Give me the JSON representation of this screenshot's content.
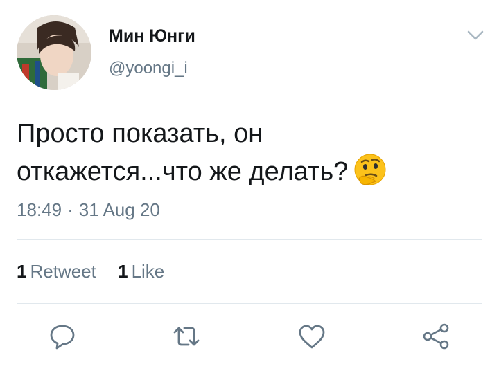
{
  "tweet": {
    "author": {
      "display_name": "Мин Юнги",
      "handle": "@yoongi_i"
    },
    "text_lines": [
      "Просто показать, он",
      "откажется...что же делать?"
    ],
    "emoji": "thinking-face",
    "time": "18:49",
    "separator": "·",
    "date": "31 Aug 20",
    "stats": {
      "retweets_count": "1",
      "retweets_label": "Retweet",
      "likes_count": "1",
      "likes_label": "Like"
    },
    "actions": [
      "reply-icon",
      "retweet-icon",
      "like-icon",
      "share-icon"
    ]
  },
  "colors": {
    "text_primary": "#14171a",
    "text_secondary": "#657786",
    "divider": "#e1e8ed",
    "emoji_yellow": "#fcc21b"
  }
}
